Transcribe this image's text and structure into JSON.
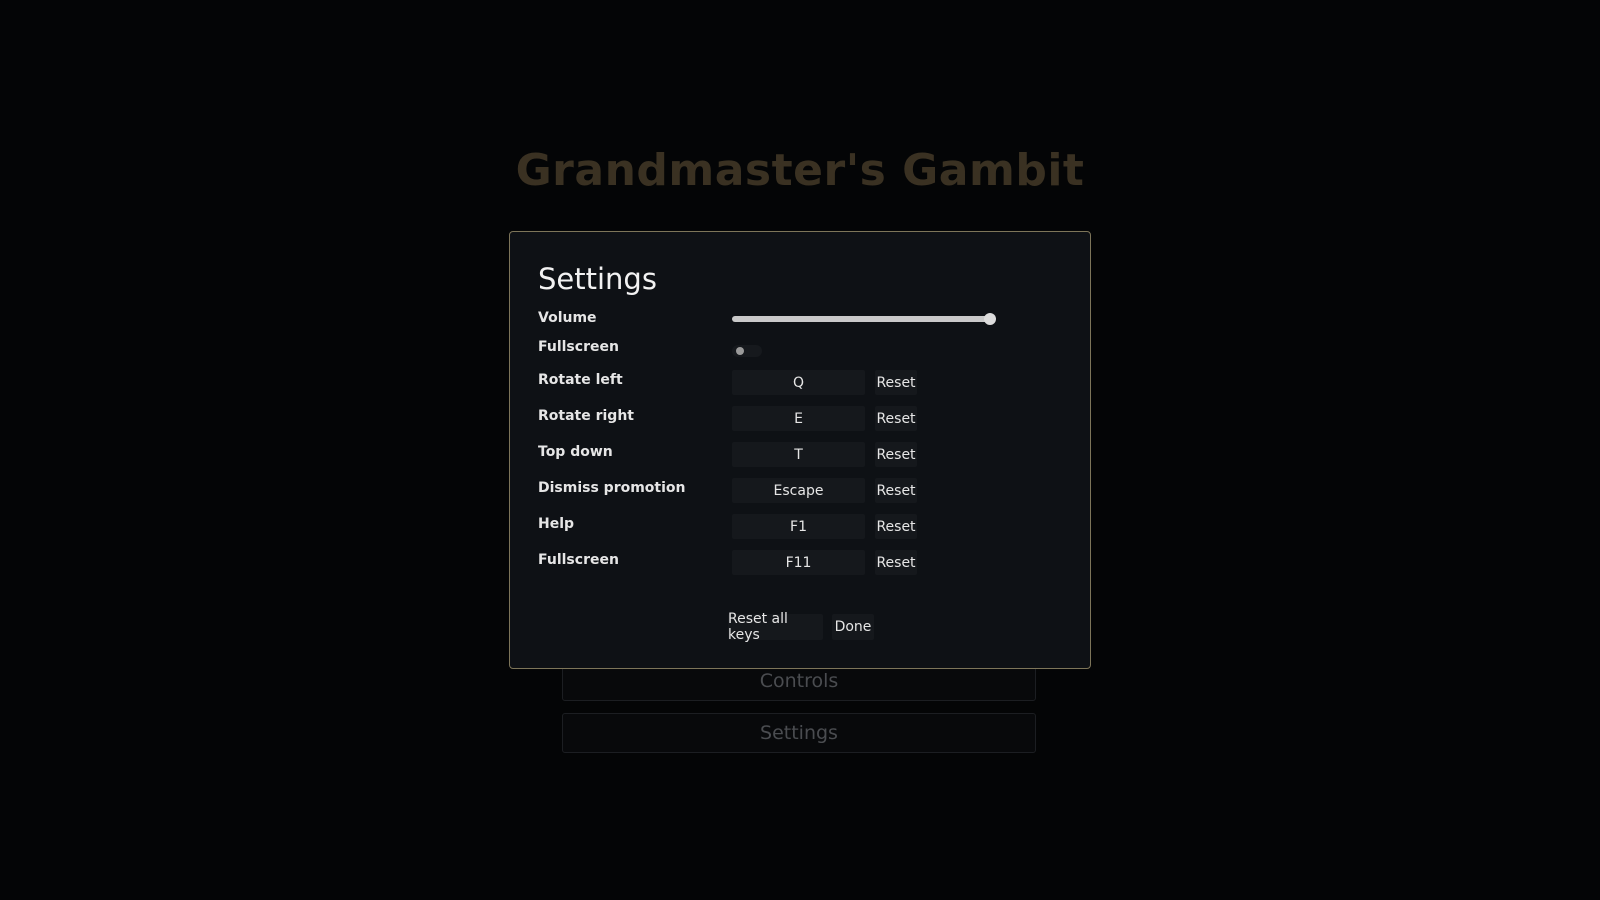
{
  "game": {
    "title": "Grandmaster's Gambit"
  },
  "menu": {
    "items": [
      {
        "label": "Controls"
      },
      {
        "label": "Settings"
      }
    ]
  },
  "settings": {
    "title": "Settings",
    "volume": {
      "label": "Volume",
      "value_fraction": 1.0
    },
    "fullscreen_toggle": {
      "label": "Fullscreen",
      "on": false
    },
    "keybinds": [
      {
        "action": "Rotate left",
        "key": "Q",
        "reset_label": "Reset"
      },
      {
        "action": "Rotate right",
        "key": "E",
        "reset_label": "Reset"
      },
      {
        "action": "Top down",
        "key": "T",
        "reset_label": "Reset"
      },
      {
        "action": "Dismiss promotion",
        "key": "Escape",
        "reset_label": "Reset"
      },
      {
        "action": "Help",
        "key": "F1",
        "reset_label": "Reset"
      },
      {
        "action": "Fullscreen",
        "key": "F11",
        "reset_label": "Reset"
      }
    ],
    "reset_all_label": "Reset all keys",
    "done_label": "Done"
  },
  "colors": {
    "dialog_border": "#7d7559",
    "title_dim": "#3a3122",
    "background": "#040506"
  }
}
